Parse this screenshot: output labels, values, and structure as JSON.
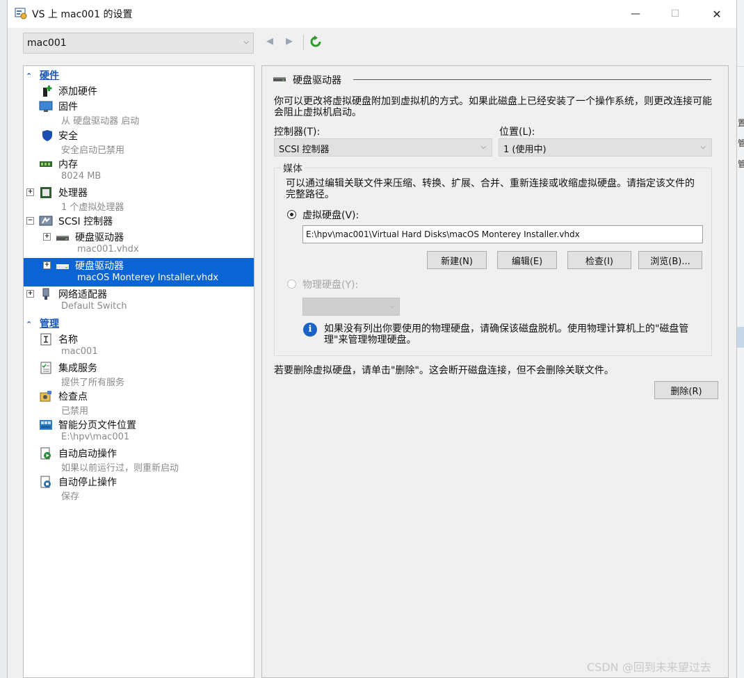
{
  "window": {
    "title": "VS 上 mac001 的设置",
    "minimize": "—",
    "maximize": "☐",
    "close": "✕"
  },
  "vm_select": {
    "value": "mac001"
  },
  "nav": {
    "back": "◀",
    "forward": "▶"
  },
  "tree": {
    "hardware_section": "硬件",
    "management_section": "管理",
    "items": [
      {
        "label": "添加硬件",
        "sub": ""
      },
      {
        "label": "固件",
        "sub": "从 硬盘驱动器 启动"
      },
      {
        "label": "安全",
        "sub": "安全启动已禁用"
      },
      {
        "label": "内存",
        "sub": "8024 MB"
      },
      {
        "label": "处理器",
        "sub": "1 个虚拟处理器"
      },
      {
        "label": "SCSI 控制器",
        "sub": ""
      },
      {
        "label": "硬盘驱动器",
        "sub": "mac001.vhdx"
      },
      {
        "label": "硬盘驱动器",
        "sub": "macOS Monterey Installer.vhdx"
      },
      {
        "label": "网络适配器",
        "sub": "Default Switch"
      }
    ],
    "mgmt_items": [
      {
        "label": "名称",
        "sub": "mac001"
      },
      {
        "label": "集成服务",
        "sub": "提供了所有服务"
      },
      {
        "label": "检查点",
        "sub": "已禁用"
      },
      {
        "label": "智能分页文件位置",
        "sub": "E:\\hpv\\mac001"
      },
      {
        "label": "自动启动操作",
        "sub": "如果以前运行过，则重新启动"
      },
      {
        "label": "自动停止操作",
        "sub": "保存"
      }
    ]
  },
  "panel": {
    "title": "硬盘驱动器",
    "description": "你可以更改将虚拟硬盘附加到虚拟机的方式。如果此磁盘上已经安装了一个操作系统，则更改连接可能会阻止虚拟机启动。",
    "controller_label": "控制器(T):",
    "controller_value": "SCSI 控制器",
    "location_label": "位置(L):",
    "location_value": "1 (使用中)",
    "media_label": "媒体",
    "media_desc": "可以通过编辑关联文件来压缩、转换、扩展、合并、重新连接或收缩虚拟硬盘。请指定该文件的完整路径。",
    "vhd_label": "虚拟硬盘(V):",
    "vhd_path": "E:\\hpv\\mac001\\Virtual Hard Disks\\macOS Monterey Installer.vhdx",
    "btn_new": "新建(N)",
    "btn_edit": "编辑(E)",
    "btn_inspect": "检查(I)",
    "btn_browse": "浏览(B)...",
    "physical_label": "物理硬盘(Y):",
    "info_text": "如果没有列出你要使用的物理硬盘，请确保该磁盘脱机。使用物理计算机上的\"磁盘管理\"来管理物理硬盘。",
    "remove_text": "若要删除虚拟硬盘，请单击\"删除\"。这会断开磁盘连接，但不会删除关联文件。",
    "btn_remove": "删除(R)"
  },
  "background": {
    "texts": [
      "置",
      "管",
      "管"
    ]
  },
  "watermark": "CSDN @回到未来望过去"
}
